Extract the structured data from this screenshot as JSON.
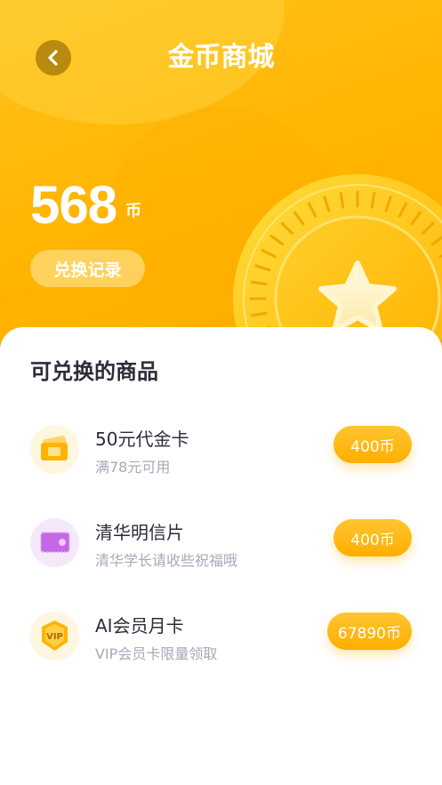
{
  "header": {
    "title": "金币商城"
  },
  "balance": {
    "amount": "568",
    "unit": "币"
  },
  "record_button": "兑换记录",
  "section": {
    "title": "可兑换的商品"
  },
  "items": [
    {
      "name": "50元代金卡",
      "desc": "满78元可用",
      "price": "400币",
      "icon": "voucher-icon"
    },
    {
      "name": "清华明信片",
      "desc": "清华学长请收些祝福哦",
      "price": "400币",
      "icon": "postcard-icon"
    },
    {
      "name": "AI会员月卡",
      "desc": "VIP会员卡限量领取",
      "price": "67890币",
      "icon": "vip-badge-icon",
      "badge_text": "VIP"
    }
  ],
  "colors": {
    "accent": "#ffb400",
    "price_button": "#ffae00",
    "text_dark": "#2b2d3a",
    "text_muted": "#a6a9b8"
  }
}
